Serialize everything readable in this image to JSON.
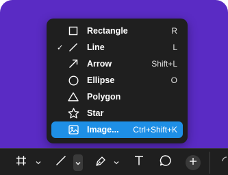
{
  "menu": {
    "items": [
      {
        "label": "Rectangle",
        "shortcut": "R",
        "icon": "rectangle-icon",
        "checked": false,
        "highlighted": false
      },
      {
        "label": "Line",
        "shortcut": "L",
        "icon": "line-icon",
        "checked": true,
        "highlighted": false
      },
      {
        "label": "Arrow",
        "shortcut": "Shift+L",
        "icon": "arrow-icon",
        "checked": false,
        "highlighted": false
      },
      {
        "label": "Ellipse",
        "shortcut": "O",
        "icon": "ellipse-icon",
        "checked": false,
        "highlighted": false
      },
      {
        "label": "Polygon",
        "shortcut": "",
        "icon": "polygon-icon",
        "checked": false,
        "highlighted": false
      },
      {
        "label": "Star",
        "shortcut": "",
        "icon": "star-icon",
        "checked": false,
        "highlighted": false
      },
      {
        "label": "Image...",
        "shortcut": "Ctrl+Shift+K",
        "icon": "image-icon",
        "checked": false,
        "highlighted": true
      }
    ],
    "check_glyph": "✓"
  },
  "toolbar": {
    "tools": [
      "frame-icon",
      "line-icon",
      "pen-icon",
      "text-icon",
      "comment-icon",
      "plus-icon"
    ]
  },
  "colors": {
    "canvas": "#5a2bc4",
    "menu_bg": "#1f1f1f",
    "highlight": "#1e8fe6"
  }
}
